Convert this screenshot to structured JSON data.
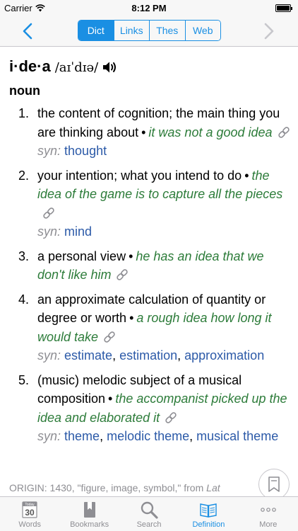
{
  "status_bar": {
    "carrier": "Carrier",
    "time": "8:12 PM",
    "battery_level": 1.0
  },
  "nav": {
    "back_icon": "chevron-left-icon",
    "forward_icon": "chevron-right-icon",
    "segments": [
      "Dict",
      "Links",
      "Thes",
      "Web"
    ],
    "selected_segment": "Dict",
    "accent_color": "#1a8fe3"
  },
  "entry": {
    "headword": "i·de·a",
    "pronunciation": "/aɪˈdɪə/",
    "part_of_speech": "noun",
    "senses": [
      {
        "number": "1.",
        "definition": "the content of cognition; the main thing you are thinking about",
        "example": "it was not a good idea",
        "syn_label": "syn:",
        "synonyms": [
          "thought"
        ]
      },
      {
        "number": "2.",
        "definition": "your intention; what you intend to do",
        "example": "the idea of the game is to capture all the pieces",
        "syn_label": "syn:",
        "synonyms": [
          "mind"
        ]
      },
      {
        "number": "3.",
        "definition": "a personal view",
        "example": "he has an idea that we don't like him",
        "syn_label": "",
        "synonyms": []
      },
      {
        "number": "4.",
        "definition": "an approximate calculation of quantity or degree or worth",
        "example": "a rough idea how long it would take",
        "syn_label": "syn:",
        "synonyms": [
          "estimate",
          "estimation",
          "approximation"
        ]
      },
      {
        "number": "5.",
        "definition": "(music) melodic subject of a musical composition",
        "example": "the accompanist picked up the idea and elaborated it",
        "syn_label": "syn:",
        "synonyms": [
          "theme",
          "melodic theme",
          "musical theme"
        ]
      }
    ],
    "bullet": "•",
    "synonym_separator": ", ",
    "origin_prefix": "ORIGIN: 1430, \"figure, image, symbol,\" from ",
    "origin_lat": "Lat",
    "example_color": "#2d7c3a",
    "synonym_color": "#2c5aa8"
  },
  "tabs": [
    {
      "label": "Words",
      "icon": "calendar-today-icon",
      "calendar_header": "Today",
      "calendar_day": "30",
      "active": false
    },
    {
      "label": "Bookmarks",
      "icon": "bookmark-icon",
      "active": false
    },
    {
      "label": "Search",
      "icon": "search-icon",
      "active": false
    },
    {
      "label": "Definition",
      "icon": "open-book-icon",
      "active": true
    },
    {
      "label": "More",
      "icon": "more-dots-icon",
      "active": false
    }
  ]
}
